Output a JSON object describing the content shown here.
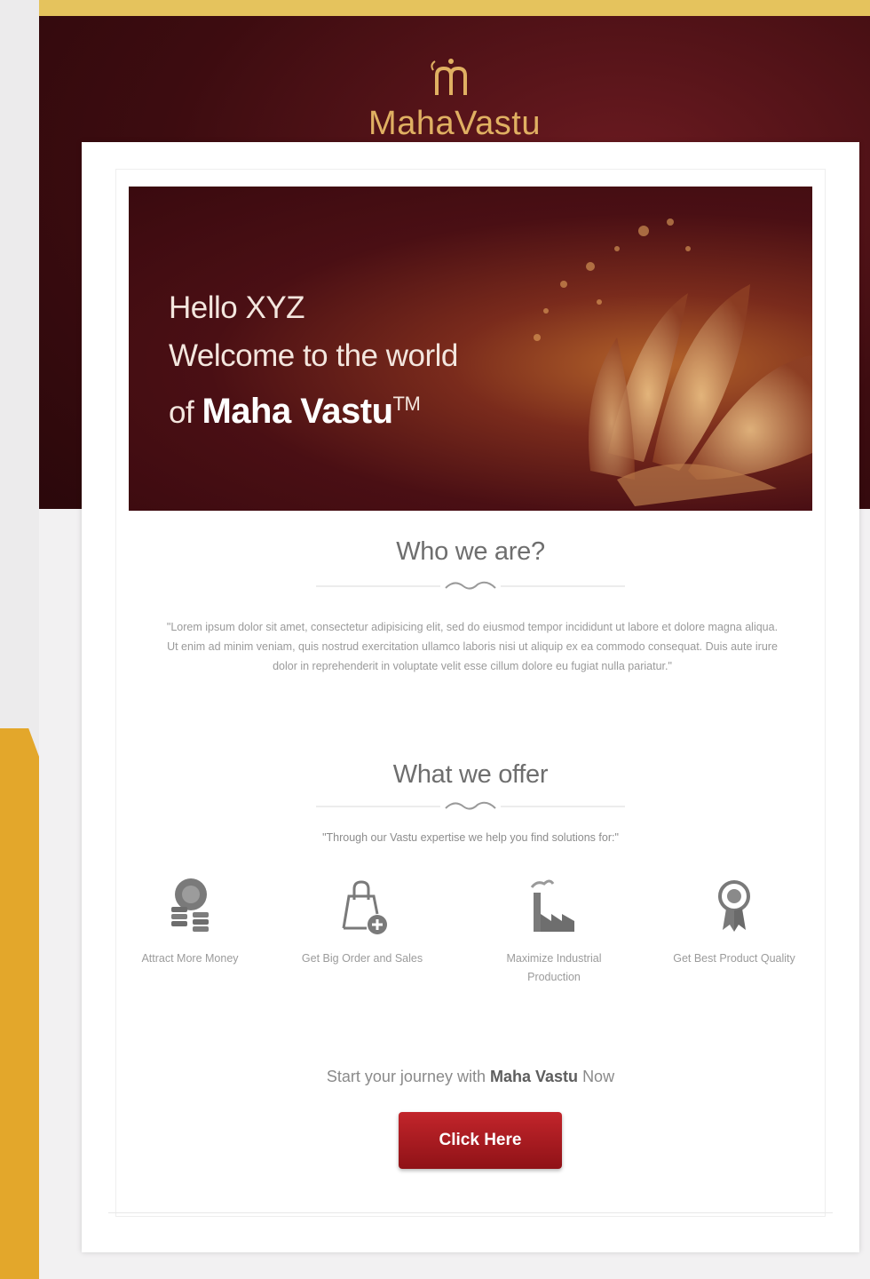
{
  "header": {
    "logo_text": "MahaVastu",
    "logo_icon": "maha-vastu-m-logo-icon",
    "band_color": "#3d0c10",
    "logo_color": "#e0b062"
  },
  "hero": {
    "line1": "Hello XYZ",
    "line2": "Welcome to the world",
    "line3_prefix": "of",
    "brand": "Maha Vastu",
    "trademark": "TM"
  },
  "about": {
    "title": "Who we are?",
    "paragraph": "\"Lorem ipsum dolor sit amet, consectetur adipisicing elit, sed do eiusmod tempor incididunt ut labore et dolore magna aliqua. Ut enim ad minim veniam, quis nostrud exercitation ullamco laboris nisi ut aliquip ex ea commodo consequat. Duis aute irure dolor in reprehenderit in voluptate velit esse cillum dolore eu fugiat nulla pariatur.\""
  },
  "offer": {
    "title": "What we offer",
    "tagline": "\"Through our Vastu expertise we help you find solutions for:\"",
    "features": [
      {
        "icon": "money-icon",
        "label": "Attract More Money"
      },
      {
        "icon": "shopping-bag-icon",
        "label": "Get Big Order and Sales"
      },
      {
        "icon": "factory-icon",
        "label": "Maximize Industrial Production"
      },
      {
        "icon": "award-ribbon-icon",
        "label": "Get Best Product Quality"
      }
    ]
  },
  "cta": {
    "prefix": "Start your journey with",
    "brand": "Maha Vastu",
    "suffix": "Now",
    "button_label": "Click Here",
    "button_color": "#b01c22"
  },
  "colors": {
    "accent_gold": "#e3a72b",
    "text_gray": "#9a9a9a"
  }
}
